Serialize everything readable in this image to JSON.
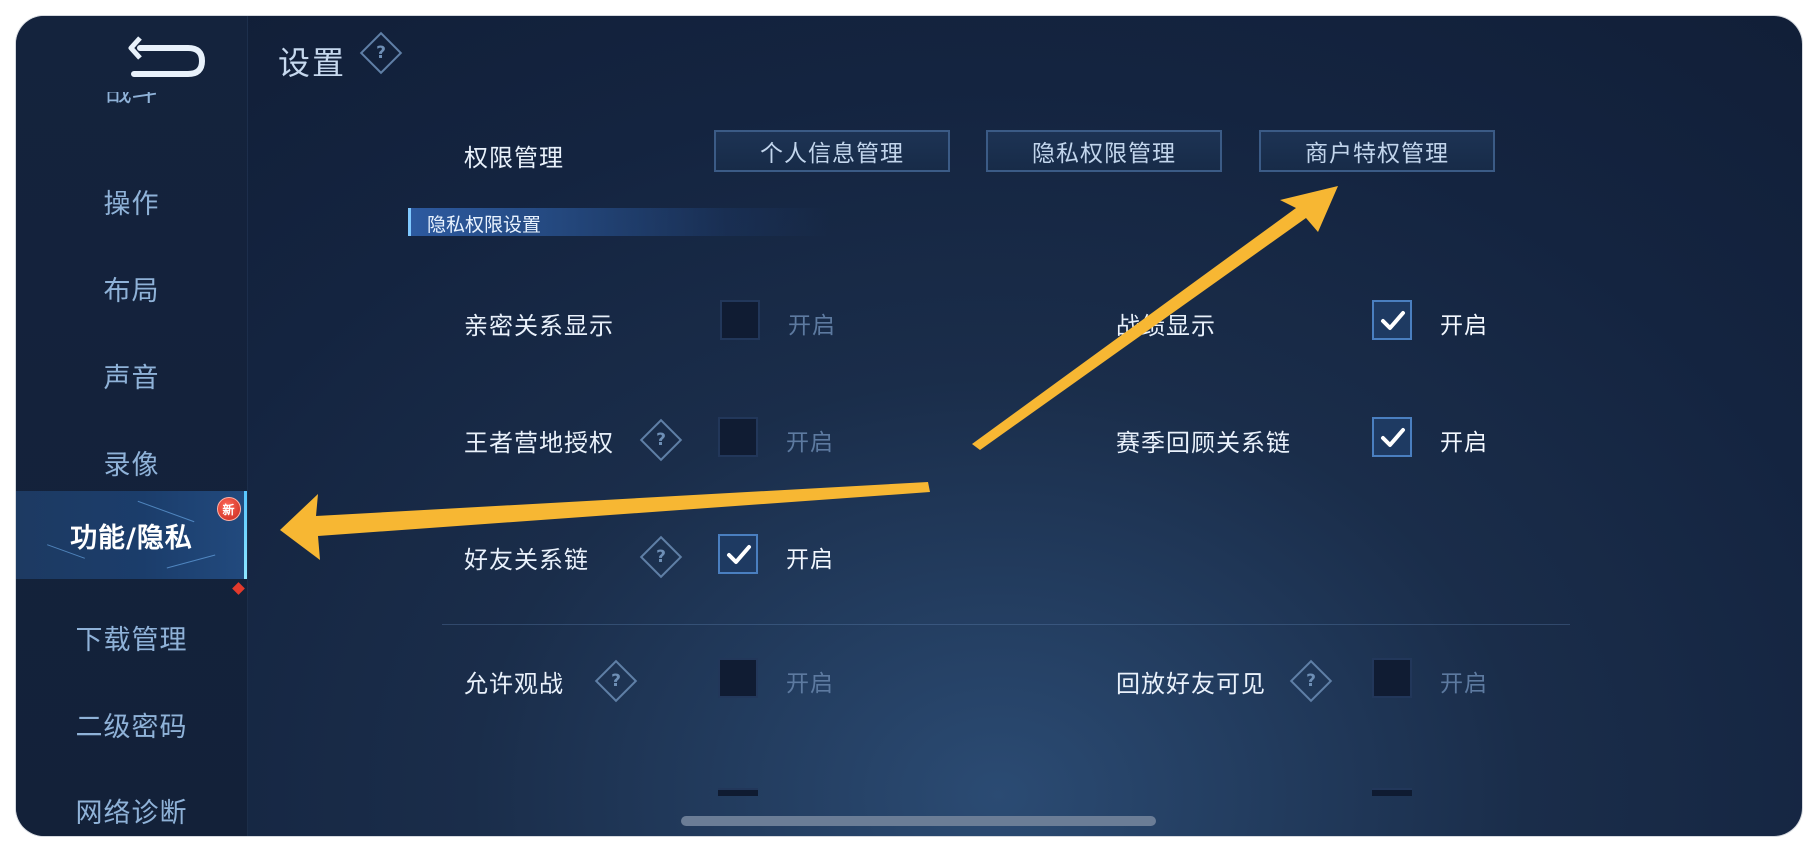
{
  "header": {
    "title": "设置",
    "help_icon_text": "?"
  },
  "sidebar": {
    "cut_item": "战斗",
    "items": [
      {
        "label": "操作"
      },
      {
        "label": "布局"
      },
      {
        "label": "声音"
      },
      {
        "label": "录像"
      },
      {
        "label": "功能/隐私",
        "active": true,
        "badge": "新"
      },
      {
        "label": "下载管理"
      },
      {
        "label": "二级密码"
      },
      {
        "label": "网络诊断"
      }
    ]
  },
  "permissions": {
    "label": "权限管理",
    "buttons": [
      "个人信息管理",
      "隐私权限管理",
      "商户特权管理"
    ]
  },
  "section_title": "隐私权限设置",
  "settings": {
    "intimacy": {
      "label": "亲密关系显示",
      "checked": false,
      "state_label": "开启"
    },
    "record": {
      "label": "战绩显示",
      "checked": true,
      "state_label": "开启"
    },
    "camp": {
      "label": "王者营地授权",
      "checked": false,
      "state_label": "开启",
      "help": "?"
    },
    "season": {
      "label": "赛季回顾关系链",
      "checked": true,
      "state_label": "开启"
    },
    "friend_chain": {
      "label": "好友关系链",
      "checked": true,
      "state_label": "开启",
      "help": "?"
    },
    "spectate": {
      "label": "允许观战",
      "checked": false,
      "state_label": "开启",
      "help": "?"
    },
    "replay": {
      "label": "回放好友可见",
      "checked": false,
      "state_label": "开启",
      "help": "?"
    }
  },
  "colors": {
    "accent_arrow": "#f7b733",
    "check_blue": "#4a7fc0"
  }
}
